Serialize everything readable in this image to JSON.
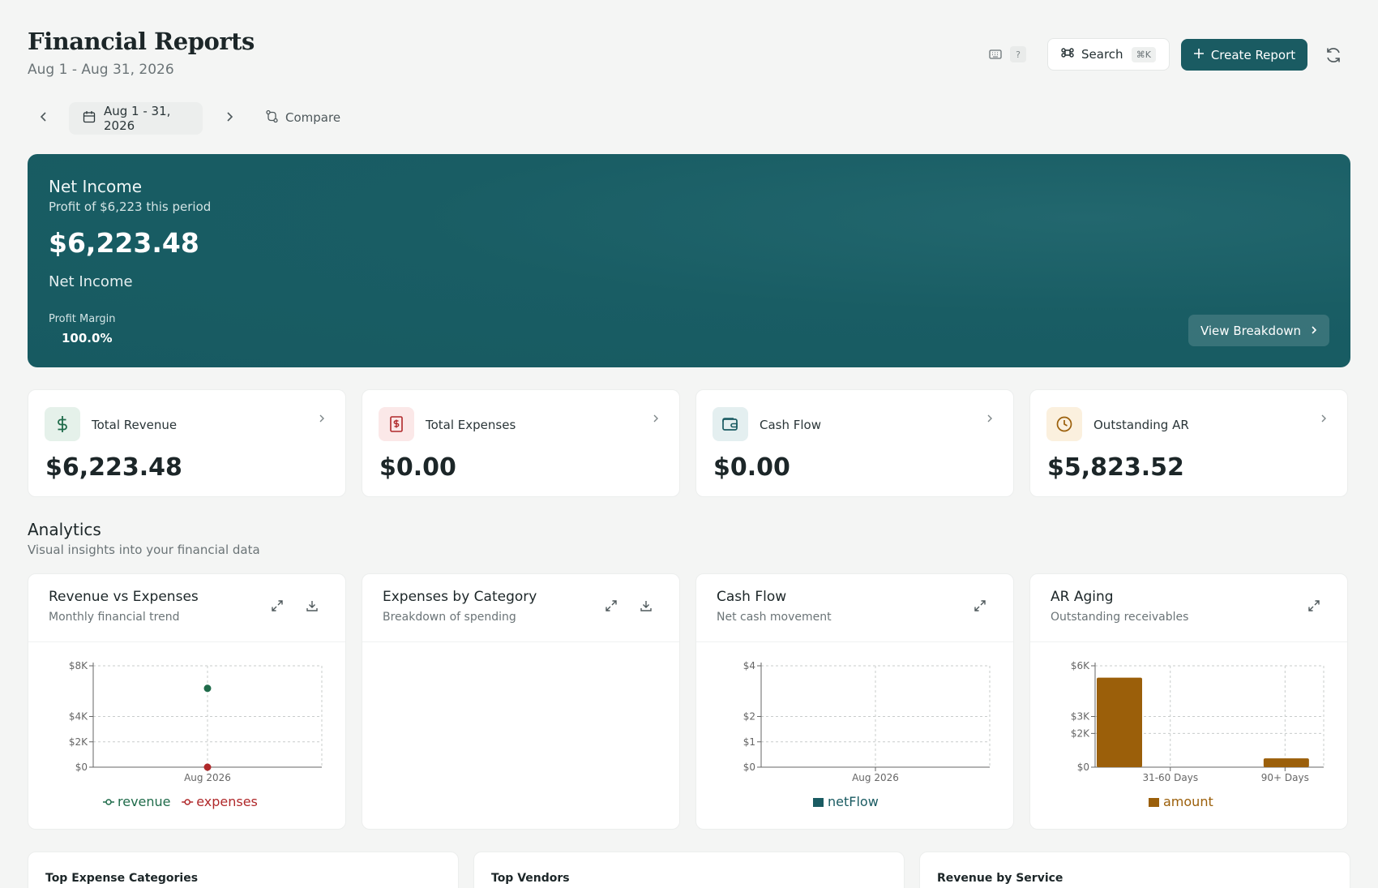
{
  "header": {
    "title": "Financial Reports",
    "subtitle": "Aug 1 - Aug 31, 2026",
    "help_badge": "?",
    "search_label": "Search",
    "search_shortcut": "⌘K",
    "create_label": "Create Report"
  },
  "date_nav": {
    "range_label": "Aug 1 - 31, 2026",
    "compare_label": "Compare"
  },
  "hero": {
    "title": "Net Income",
    "subtitle": "Profit of $6,223 this period",
    "value": "$6,223.48",
    "value_label": "Net Income",
    "metric_label": "Profit Margin",
    "metric_value": "100.0%",
    "breakdown_label": "View Breakdown"
  },
  "kpis": [
    {
      "label": "Total Revenue",
      "value": "$6,223.48",
      "icon": "dollar-icon"
    },
    {
      "label": "Total Expenses",
      "value": "$0.00",
      "icon": "receipt-icon"
    },
    {
      "label": "Cash Flow",
      "value": "$0.00",
      "icon": "wallet-icon"
    },
    {
      "label": "Outstanding AR",
      "value": "$5,823.52",
      "icon": "clock-icon"
    }
  ],
  "analytics": {
    "title": "Analytics",
    "subtitle": "Visual insights into your financial data"
  },
  "cards": [
    {
      "title": "Revenue vs Expenses",
      "subtitle": "Monthly financial trend"
    },
    {
      "title": "Expenses by Category",
      "subtitle": "Breakdown of spending"
    },
    {
      "title": "Cash Flow",
      "subtitle": "Net cash movement"
    },
    {
      "title": "AR Aging",
      "subtitle": "Outstanding receivables"
    }
  ],
  "bottom_cards": [
    {
      "title": "Top Expense Categories"
    },
    {
      "title": "Top Vendors"
    },
    {
      "title": "Revenue by Service"
    }
  ],
  "colors": {
    "brand": "#1a5b62",
    "revenue": "#1f6b4a",
    "expenses": "#b0282a",
    "netflow": "#1a5b62",
    "amount": "#9b5f0a"
  },
  "chart_data": [
    {
      "type": "line",
      "title": "Revenue vs Expenses",
      "categories": [
        "Aug 2026"
      ],
      "y_ticks": [
        "$0",
        "$2K",
        "$4K",
        "$8K"
      ],
      "series": [
        {
          "name": "revenue",
          "values": [
            6223.48
          ]
        },
        {
          "name": "expenses",
          "values": [
            0
          ]
        }
      ],
      "grid": true,
      "legend": "bottom"
    },
    {
      "type": "bar",
      "title": "Cash Flow",
      "categories": [
        "Aug 2026"
      ],
      "y_ticks": [
        "$0",
        "$1",
        "$2",
        "$4"
      ],
      "series": [
        {
          "name": "netFlow",
          "values": [
            0
          ]
        }
      ],
      "grid": true,
      "legend": "bottom"
    },
    {
      "type": "bar",
      "title": "AR Aging",
      "categories": [
        "31-60 Days",
        "90+ Days"
      ],
      "y_ticks": [
        "$0",
        "$2K",
        "$3K",
        "$6K"
      ],
      "series": [
        {
          "name": "amount",
          "values": [
            5300,
            520
          ]
        }
      ],
      "grid": true,
      "legend": "bottom"
    }
  ]
}
